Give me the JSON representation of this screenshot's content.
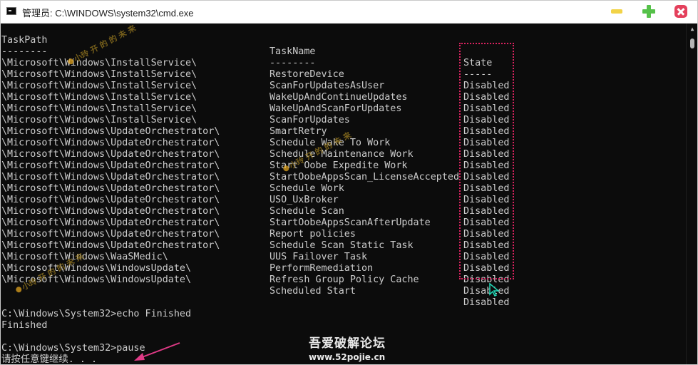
{
  "window": {
    "title": "管理员: C:\\WINDOWS\\system32\\cmd.exe"
  },
  "table": {
    "headers": {
      "path": "TaskPath",
      "name": "TaskName",
      "state": "State"
    },
    "separators": {
      "path": "--------",
      "name": "--------",
      "state": "-----"
    },
    "rows": [
      {
        "path": "\\Microsoft\\Windows\\InstallService\\",
        "name": "RestoreDevice",
        "state": "Disabled"
      },
      {
        "path": "\\Microsoft\\Windows\\InstallService\\",
        "name": "ScanForUpdatesAsUser",
        "state": "Disabled"
      },
      {
        "path": "\\Microsoft\\Windows\\InstallService\\",
        "name": "WakeUpAndContinueUpdates",
        "state": "Disabled"
      },
      {
        "path": "\\Microsoft\\Windows\\InstallService\\",
        "name": "WakeUpAndScanForUpdates",
        "state": "Disabled"
      },
      {
        "path": "\\Microsoft\\Windows\\InstallService\\",
        "name": "ScanForUpdates",
        "state": "Disabled"
      },
      {
        "path": "\\Microsoft\\Windows\\InstallService\\",
        "name": "SmartRetry",
        "state": "Disabled"
      },
      {
        "path": "\\Microsoft\\Windows\\UpdateOrchestrator\\",
        "name": "Schedule Wake To Work",
        "state": "Disabled"
      },
      {
        "path": "\\Microsoft\\Windows\\UpdateOrchestrator\\",
        "name": "Schedule Maintenance Work",
        "state": "Disabled"
      },
      {
        "path": "\\Microsoft\\Windows\\UpdateOrchestrator\\",
        "name": "Start Oobe Expedite Work",
        "state": "Disabled"
      },
      {
        "path": "\\Microsoft\\Windows\\UpdateOrchestrator\\",
        "name": "StartOobeAppsScan_LicenseAccepted",
        "state": "Disabled"
      },
      {
        "path": "\\Microsoft\\Windows\\UpdateOrchestrator\\",
        "name": "Schedule Work",
        "state": "Disabled"
      },
      {
        "path": "\\Microsoft\\Windows\\UpdateOrchestrator\\",
        "name": "USO_UxBroker",
        "state": "Disabled"
      },
      {
        "path": "\\Microsoft\\Windows\\UpdateOrchestrator\\",
        "name": "Schedule Scan",
        "state": "Disabled"
      },
      {
        "path": "\\Microsoft\\Windows\\UpdateOrchestrator\\",
        "name": "StartOobeAppsScanAfterUpdate",
        "state": "Disabled"
      },
      {
        "path": "\\Microsoft\\Windows\\UpdateOrchestrator\\",
        "name": "Report policies",
        "state": "Disabled"
      },
      {
        "path": "\\Microsoft\\Windows\\UpdateOrchestrator\\",
        "name": "Schedule Scan Static Task",
        "state": "Disabled"
      },
      {
        "path": "\\Microsoft\\Windows\\UpdateOrchestrator\\",
        "name": "UUS Failover Task",
        "state": "Disabled"
      },
      {
        "path": "\\Microsoft\\Windows\\WaaSMedic\\",
        "name": "PerformRemediation",
        "state": "Disabled"
      },
      {
        "path": "\\Microsoft\\Windows\\WindowsUpdate\\",
        "name": "Refresh Group Policy Cache",
        "state": "Disabled"
      },
      {
        "path": "\\Microsoft\\Windows\\WindowsUpdate\\",
        "name": "Scheduled Start",
        "state": "Disabled"
      }
    ]
  },
  "console": {
    "cmd_echo": "C:\\Windows\\System32>echo Finished",
    "echo_output": "Finished",
    "cmd_pause": "C:\\Windows\\System32>pause",
    "pause_prompt": "请按任意键继续. . ."
  },
  "watermark": {
    "text": "小玲 开 的 的 未 来"
  },
  "forum": {
    "name": "吾爱破解论坛",
    "url": "www.52pojie.cn"
  },
  "colors": {
    "console_bg": "#0c0c0c",
    "console_fg": "#cccccc",
    "highlight": "#d9225f",
    "arrow": "#e03a86",
    "cursor": "#1fd6b4"
  }
}
